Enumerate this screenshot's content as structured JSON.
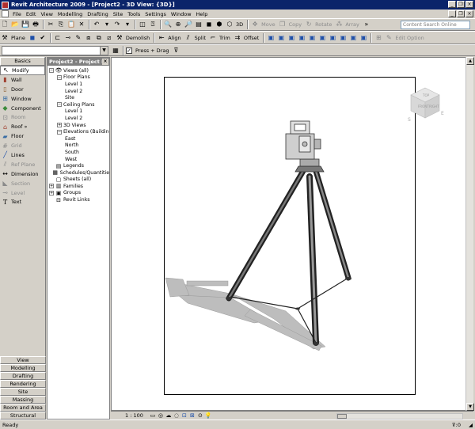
{
  "window": {
    "title": "Revit Architecture 2009 - [Project2 - 3D View: {3D}]",
    "minimize": "_",
    "restore": "❐",
    "close": "×"
  },
  "menu": [
    "File",
    "Edit",
    "View",
    "Modelling",
    "Drafting",
    "Site",
    "Tools",
    "Settings",
    "Window",
    "Help"
  ],
  "toolbar1": {
    "label_3d": "3D",
    "move": "Move",
    "copy": "Copy",
    "rotate": "Rotate",
    "array": "Array",
    "search_placeholder": "Content Search Online"
  },
  "toolbar2": {
    "plane": "Plane",
    "demolish": "Demolish",
    "align": "Align",
    "split": "Split",
    "trim": "Trim",
    "offset": "Offset",
    "edit_option": "Edit Option"
  },
  "toolbar3": {
    "press_drag": "Press + Drag"
  },
  "designbar": {
    "tab": "Basics",
    "items": [
      {
        "label": "Modify",
        "icon": "arrow-cursor-icon"
      },
      {
        "label": "Wall",
        "icon": "wall-icon"
      },
      {
        "label": "Door",
        "icon": "door-icon"
      },
      {
        "label": "Window",
        "icon": "window-icon"
      },
      {
        "label": "Component",
        "icon": "component-icon"
      },
      {
        "label": "Room",
        "icon": "room-icon"
      },
      {
        "label": "Roof »",
        "icon": "roof-icon"
      },
      {
        "label": "Floor",
        "icon": "floor-icon"
      },
      {
        "label": "Grid",
        "icon": "grid-icon"
      },
      {
        "label": "Lines",
        "icon": "lines-icon"
      },
      {
        "label": "Ref Plane",
        "icon": "ref-plane-icon"
      },
      {
        "label": "Dimension",
        "icon": "dimension-icon"
      },
      {
        "label": "Section",
        "icon": "section-icon"
      },
      {
        "label": "Level",
        "icon": "level-icon"
      },
      {
        "label": "Text",
        "icon": "text-icon"
      }
    ],
    "bottom_tabs": [
      "View",
      "Modelling",
      "Drafting",
      "Rendering",
      "Site",
      "Massing",
      "Room and Area",
      "Structural"
    ]
  },
  "project_browser": {
    "title": "Project2 - Project Br...",
    "close": "×",
    "tree": [
      {
        "label": "Views (all)",
        "depth": 0,
        "expander": "−",
        "icon": "eyeglasses-icon"
      },
      {
        "label": "Floor Plans",
        "depth": 1,
        "expander": "−"
      },
      {
        "label": "Level 1",
        "depth": 2
      },
      {
        "label": "Level 2",
        "depth": 2
      },
      {
        "label": "Site",
        "depth": 2
      },
      {
        "label": "Ceiling Plans",
        "depth": 1,
        "expander": "−"
      },
      {
        "label": "Level 1",
        "depth": 2
      },
      {
        "label": "Level 2",
        "depth": 2
      },
      {
        "label": "3D Views",
        "depth": 1,
        "expander": "+"
      },
      {
        "label": "Elevations (Building",
        "depth": 1,
        "expander": "−"
      },
      {
        "label": "East",
        "depth": 2
      },
      {
        "label": "North",
        "depth": 2
      },
      {
        "label": "South",
        "depth": 2
      },
      {
        "label": "West",
        "depth": 2
      },
      {
        "label": "Legends",
        "depth": 0,
        "icon": "legend-icon"
      },
      {
        "label": "Schedules/Quantitie",
        "depth": 0,
        "icon": "schedule-icon"
      },
      {
        "label": "Sheets (all)",
        "depth": 0,
        "icon": "sheet-icon"
      },
      {
        "label": "Families",
        "depth": 0,
        "expander": "+",
        "icon": "families-icon"
      },
      {
        "label": "Groups",
        "depth": 0,
        "expander": "+",
        "icon": "groups-icon"
      },
      {
        "label": "Revit Links",
        "depth": 0,
        "icon": "links-icon"
      }
    ]
  },
  "viewcube": {
    "front": "FRONT",
    "right": "RIGHT",
    "top": "TOP",
    "s": "S",
    "e": "E"
  },
  "viewctrl": {
    "scale": "1 : 100"
  },
  "status": {
    "text": "Ready",
    "filter": ":0"
  }
}
